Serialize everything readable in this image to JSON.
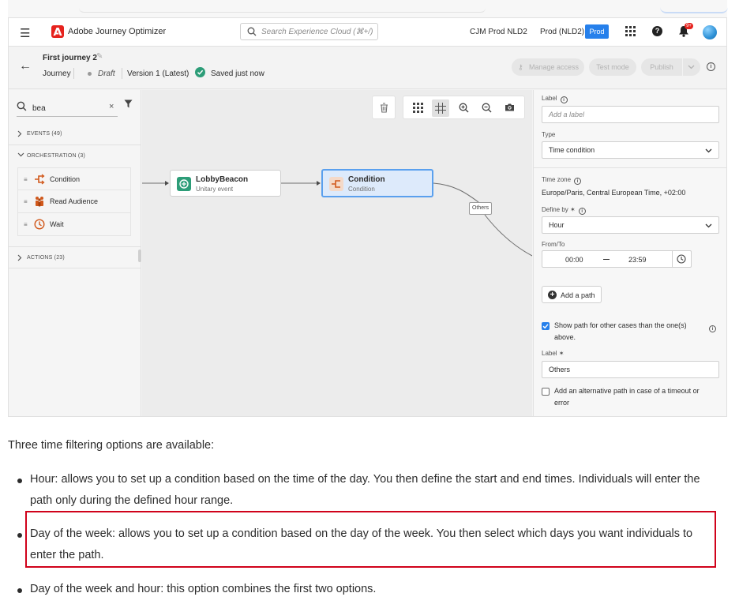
{
  "app": {
    "title": "Adobe Journey Optimizer",
    "search_placeholder": "Search Experience Cloud (⌘+/)",
    "org": "CJM Prod NLD2",
    "sandbox": "Prod (NLD2)",
    "sandbox_badge": "Prod",
    "notification_count": "9+",
    "brand_color": "#e6231e",
    "accent_color": "#2680eb"
  },
  "journey": {
    "name": "First journey 2",
    "type": "Journey",
    "status": "Draft",
    "version": "Version 1 (Latest)",
    "save_state": "Saved just now",
    "manage_access_label": "Manage access",
    "test_mode_label": "Test mode",
    "publish_label": "Publish"
  },
  "left_panel": {
    "search_value": "bea",
    "sections": {
      "events": "EVENTS (49)",
      "orchestration": "ORCHESTRATION (3)",
      "actions": "ACTIONS (23)"
    },
    "orchestration_items": [
      {
        "label": "Condition",
        "icon": "condition-icon"
      },
      {
        "label": "Read Audience",
        "icon": "read-audience-icon"
      },
      {
        "label": "Wait",
        "icon": "wait-icon"
      }
    ]
  },
  "canvas": {
    "nodes": [
      {
        "title": "LobbyBeacon",
        "subtitle": "Unitary event",
        "icon": "beacon-event-icon"
      },
      {
        "title": "Condition",
        "subtitle": "Condition",
        "icon": "condition-icon"
      }
    ],
    "others_path_label": "Others"
  },
  "right_panel": {
    "label_title": "Label",
    "label_placeholder": "Add a label",
    "type_title": "Type",
    "type_value": "Time condition",
    "timezone_title": "Time zone",
    "timezone_value": "Europe/Paris, Central European Time, +02:00",
    "define_by_title": "Define by ✶",
    "define_by_value": "Hour",
    "from_to_title": "From/To",
    "from_time": "00:00",
    "to_time": "23:59",
    "add_path_label": "Add a path",
    "show_path_label": "Show path for other cases than the one(s) above.",
    "show_path_checked": true,
    "other_label_title": "Label ✶",
    "other_label_value": "Others",
    "timeout_label": "Add an alternative path in case of a timeout or error",
    "timeout_checked": false
  },
  "doc": {
    "intro": "Three time filtering options are available:",
    "bullets": [
      "Hour: allows you to set up a condition based on the time of the day. You then define the start and end times. Individuals will enter the path only during the defined hour range.",
      "Day of the week: allows you to set up a condition based on the day of the week. You then select which days you want individuals to enter the path.",
      "Day of the week and hour: this option combines the first two options."
    ],
    "highlight_color": "#d0021b"
  }
}
